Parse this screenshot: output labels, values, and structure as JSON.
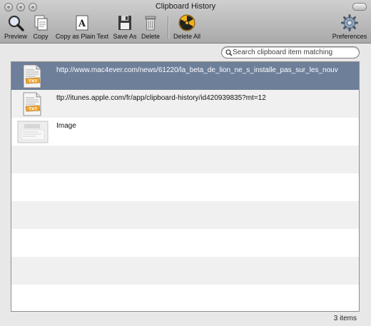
{
  "window": {
    "title": "Clipboard History"
  },
  "toolbar": {
    "preview": "Preview",
    "copy": "Copy",
    "copy_plain": "Copy as Plain Text",
    "save_as": "Save As",
    "delete": "Delete",
    "delete_all": "Delete All",
    "preferences": "Preferences"
  },
  "search": {
    "placeholder": "Search clipboard item matching",
    "value": ""
  },
  "items": [
    {
      "type": "text",
      "badge": "TXT",
      "label": "http://www.mac4ever.com/news/61220/la_beta_de_lion_ne_s_installe_pas_sur_les_nouv",
      "selected": true
    },
    {
      "type": "text",
      "badge": "TXT",
      "label": "ttp://itunes.apple.com/fr/app/clipboard-history/id420939835?mt=12",
      "selected": false
    },
    {
      "type": "image",
      "label": "Image",
      "selected": false
    }
  ],
  "status": {
    "count": "3 items"
  },
  "colors": {
    "selection": "#6e7f9a",
    "stripe": "#f0f0f0"
  },
  "icons": [
    "preview-icon",
    "copy-icon",
    "copy-plain-icon",
    "save-icon",
    "trash-icon",
    "radiation-icon",
    "gear-icon",
    "search-icon"
  ]
}
